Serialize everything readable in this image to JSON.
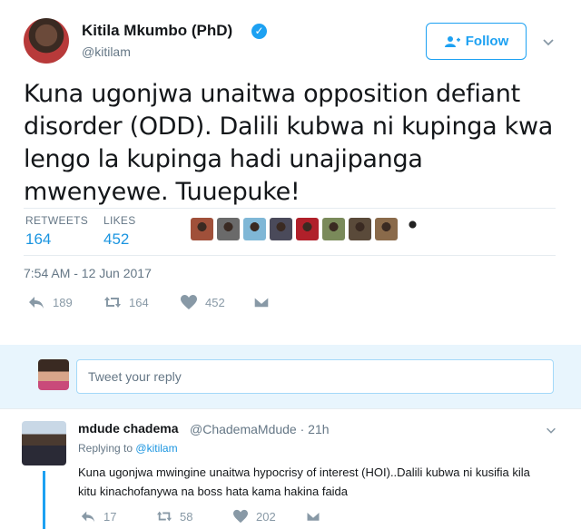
{
  "tweet": {
    "author_name": "Kitila Mkumbo (PhD)",
    "author_handle": "@kitilam",
    "follow_label": "Follow",
    "text": "Kuna ugonjwa unaitwa opposition defiant disorder (ODD). Dalili kubwa ni kupinga kwa lengo la kupinga hadi  unajipanga mwenyewe. Tuuepuke!",
    "retweets_label": "RETWEETS",
    "retweets_count": "164",
    "likes_label": "LIKES",
    "likes_count": "452",
    "timestamp": "7:54 AM - 12 Jun 2017",
    "actions": {
      "reply_count": "189",
      "retweet_count": "164",
      "like_count": "452"
    },
    "liker_colors": [
      "#a0503a",
      "#6a6a6a",
      "#7fb7d6",
      "#4a4a5a",
      "#b0202a",
      "#7a8a5a",
      "#5a4a3a",
      "#8a6a4a"
    ]
  },
  "reply_box": {
    "placeholder": "Tweet your reply"
  },
  "reply": {
    "author_name": "mdude chadema",
    "author_handle": "@ChademaMdude · 21h",
    "replying_prefix": "Replying to",
    "replying_to": "@kitilam",
    "text": "Kuna ugonjwa mwingine unaitwa hypocrisy of interest (HOI)..Dalili kubwa ni kusifia kila kitu kinachofanywa na boss hata kama hakina faida",
    "actions": {
      "reply_count": "17",
      "retweet_count": "58",
      "like_count": "202"
    }
  },
  "colors": {
    "accent": "#1da1f2",
    "link": "#1b95e0",
    "muted": "#657786",
    "reply_bg": "#e8f5fd"
  }
}
